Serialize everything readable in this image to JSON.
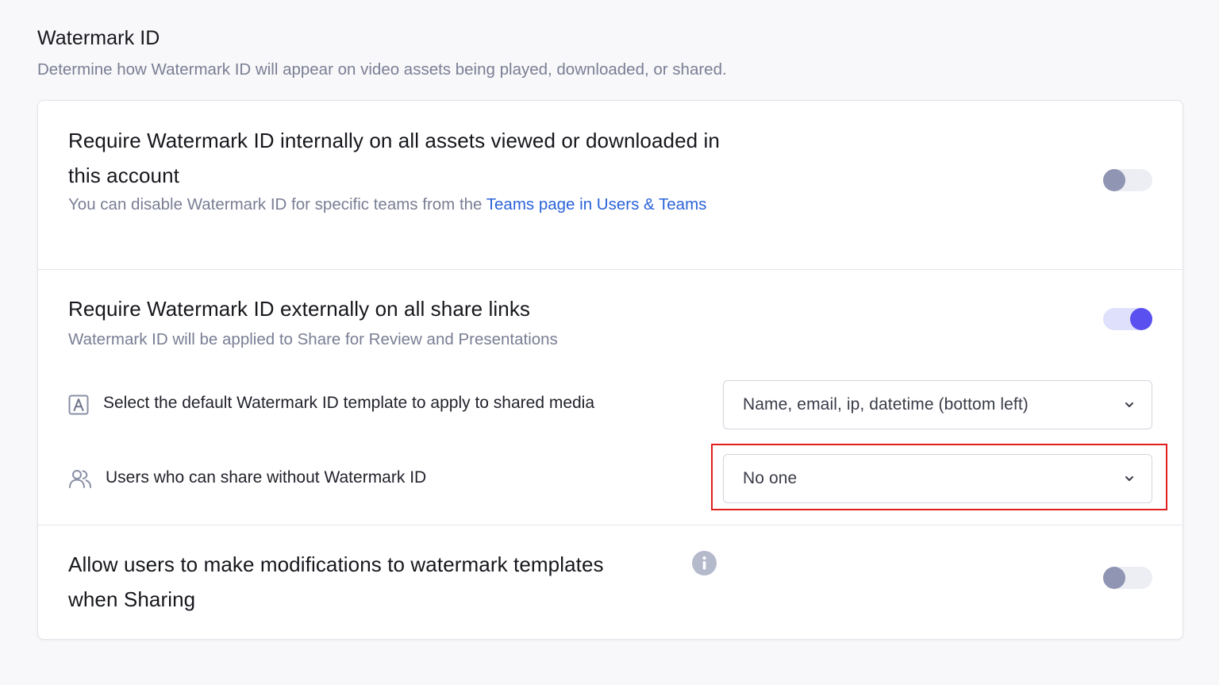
{
  "section": {
    "title": "Watermark ID",
    "description": "Determine how Watermark ID will appear on video assets being played, downloaded, or shared."
  },
  "internal": {
    "title": "Require Watermark ID internally on all assets viewed or downloaded in this account",
    "desc_prefix": "You can disable Watermark ID for specific teams from the ",
    "desc_link": "Teams page in Users & Teams",
    "toggle_on": false
  },
  "external": {
    "title": "Require Watermark ID externally on all share links",
    "desc": "Watermark ID will be applied to Share for Review and Presentations",
    "toggle_on": true
  },
  "template_option": {
    "label": "Select the default Watermark ID template to apply to shared media",
    "icon": "text-template-icon",
    "selected": "Name, email, ip, datetime (bottom left)"
  },
  "share_without_option": {
    "label": "Users who can share without Watermark ID",
    "icon": "users-icon",
    "selected": "No one"
  },
  "modifications": {
    "title": "Allow users to make modifications to watermark templates when Sharing",
    "icon": "info-icon",
    "toggle_on": false
  },
  "colors": {
    "accent": "#5a50f0",
    "link": "#2b63d9",
    "highlight": "#e0201e"
  }
}
